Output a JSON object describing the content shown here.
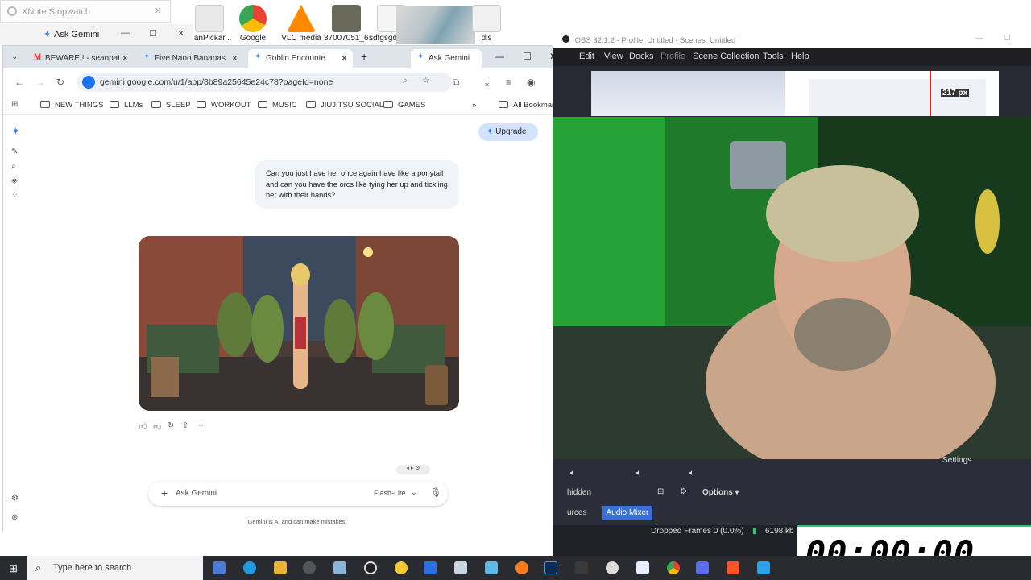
{
  "desktop": {
    "icons": [
      {
        "label": "...anPickar...",
        "color": "#e9e9e9"
      },
      {
        "label": "Google",
        "color": "#ea4335"
      },
      {
        "label": "VLC media",
        "color": "#ff8800"
      },
      {
        "label": "37007051_6...",
        "color": "#6a6a5a"
      },
      {
        "label": "sdfgsgdfhg...",
        "color": "#f5f5f5"
      },
      {
        "label": "dis",
        "color": "#f0f0f0"
      }
    ]
  },
  "xnote": {
    "title": "XNote Stopwatch"
  },
  "ask_gemini_window": {
    "title": "Ask Gemini"
  },
  "browser": {
    "tabs": [
      {
        "label": "BEWARE!! - seanpat",
        "icon": "gmail-icon"
      },
      {
        "label": "Five Nano Bananas",
        "icon": "gemini-star-icon"
      },
      {
        "label": "Goblin Encounte",
        "icon": "gemini-star-icon",
        "active": true
      },
      {
        "label": "Ask Gemini",
        "icon": "gemini-star-icon"
      }
    ],
    "new_tab": "+",
    "url": "gemini.google.com/u/1/app/8b89a25645e24c78?pageId=none",
    "bookmarks": [
      "NEW THINGS",
      "LLMs",
      "SLEEP",
      "WORKOUT",
      "MUSIC",
      "JIUJITSU SOCIAL",
      "GAMES"
    ],
    "all_bookmarks": "All Bookmarks",
    "more_bookmarks": "»"
  },
  "gemini": {
    "upgrade": "Upgrade",
    "user_message": "Can you just have her once again have like a ponytail and can you have the orcs like tying her up and tickling her with their hands?",
    "input_placeholder": "Ask Gemini",
    "model": "Flash-Lite",
    "disclaimer": "Gemini is AI and can make mistakes."
  },
  "obs": {
    "title": "OBS 32.1.2 - Profile: Untitled - Scenes: Untitled",
    "menu": [
      "Edit",
      "View",
      "Docks",
      "Profile",
      "Scene Collection",
      "Tools",
      "Help"
    ],
    "measure": "217 px",
    "settings": "Settings",
    "hidden": "hidden",
    "options": "Options",
    "sources_tab": "urces",
    "audio_mixer_tab": "Audio Mixer",
    "dropped_frames": "Dropped Frames 0 (0.0%)",
    "bitrate": "6198 kb"
  },
  "timer": {
    "value": "00:00:00"
  },
  "taskbar": {
    "search_placeholder": "Type here to search"
  },
  "colors": {
    "accent": "#1a73e8",
    "obs_bg": "#272a33",
    "upgrade_bg": "#d3e3fd"
  }
}
